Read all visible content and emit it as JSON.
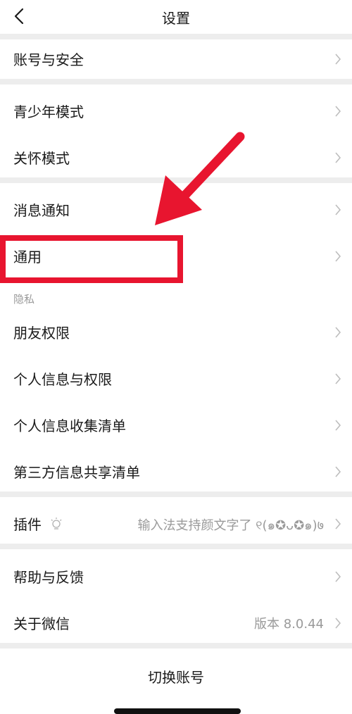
{
  "header": {
    "title": "设置"
  },
  "items": {
    "account": {
      "label": "账号与安全"
    },
    "teen": {
      "label": "青少年模式"
    },
    "care": {
      "label": "关怀模式"
    },
    "notify": {
      "label": "消息通知"
    },
    "general": {
      "label": "通用"
    },
    "privacy_header": "隐私",
    "friends": {
      "label": "朋友权限"
    },
    "personal": {
      "label": "个人信息与权限"
    },
    "collection": {
      "label": "个人信息收集清单"
    },
    "thirdparty": {
      "label": "第三方信息共享清单"
    },
    "plugins": {
      "label": "插件",
      "value": "输入法支持颜文字了 ୧(๑✪ᴗ✪๑)७"
    },
    "help": {
      "label": "帮助与反馈"
    },
    "about": {
      "label": "关于微信",
      "value": "版本 8.0.44"
    }
  },
  "footer": {
    "switch_account": "切换账号"
  },
  "colors": {
    "highlight": "#e8152f",
    "separator": "#ededed",
    "secondary_text": "#9a9a9a"
  },
  "icons": {
    "back": "chevron-left-icon",
    "row_arrow": "chevron-right-icon",
    "plugin_badge": "lightbulb-icon"
  }
}
